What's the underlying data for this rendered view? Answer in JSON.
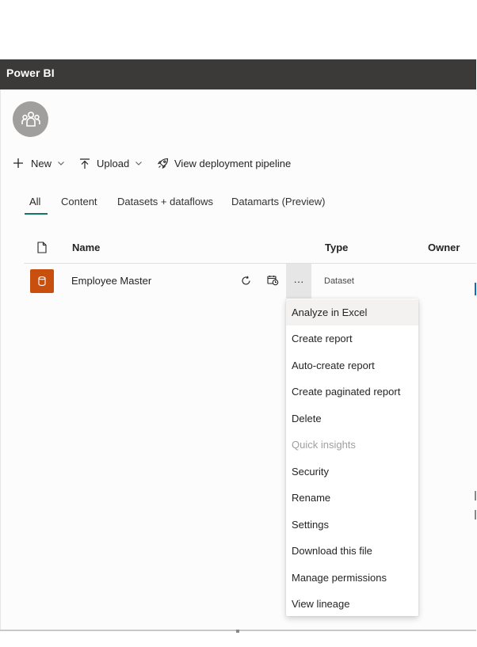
{
  "app": {
    "title": "Power BI"
  },
  "toolbar": {
    "new_label": "New",
    "upload_label": "Upload",
    "pipeline_label": "View deployment pipeline"
  },
  "tabs": [
    {
      "label": "All",
      "active": true
    },
    {
      "label": "Content",
      "active": false
    },
    {
      "label": "Datasets + dataflows",
      "active": false
    },
    {
      "label": "Datamarts (Preview)",
      "active": false
    }
  ],
  "table": {
    "headers": {
      "name": "Name",
      "type": "Type",
      "owner": "Owner"
    },
    "rows": [
      {
        "name": "Employee Master",
        "type": "Dataset"
      }
    ]
  },
  "context_menu": {
    "items": [
      {
        "label": "Analyze in Excel",
        "state": "hover"
      },
      {
        "label": "Create report",
        "state": "normal"
      },
      {
        "label": "Auto-create report",
        "state": "normal"
      },
      {
        "label": "Create paginated report",
        "state": "normal"
      },
      {
        "label": "Delete",
        "state": "normal"
      },
      {
        "label": "Quick insights",
        "state": "disabled"
      },
      {
        "label": "Security",
        "state": "normal"
      },
      {
        "label": "Rename",
        "state": "normal"
      },
      {
        "label": "Settings",
        "state": "normal"
      },
      {
        "label": "Download this file",
        "state": "normal"
      },
      {
        "label": "Manage permissions",
        "state": "normal"
      },
      {
        "label": "View lineage",
        "state": "normal"
      }
    ]
  },
  "more_label": "···",
  "colors": {
    "topbar": "#3b3a39",
    "accent": "#117865",
    "dataset_icon": "#c94f0f",
    "disabled_text": "#a19f9d"
  }
}
